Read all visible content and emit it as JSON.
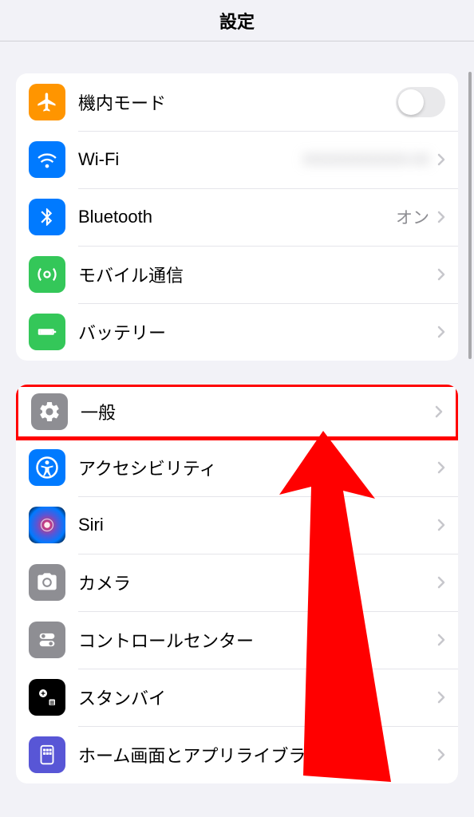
{
  "header": {
    "title": "設定"
  },
  "group1": {
    "airplane": {
      "label": "機内モード"
    },
    "wifi": {
      "label": "Wi-Fi",
      "detail": "XXXXXXXXXXXX-XX"
    },
    "bluetooth": {
      "label": "Bluetooth",
      "detail": "オン"
    },
    "cellular": {
      "label": "モバイル通信"
    },
    "battery": {
      "label": "バッテリー"
    }
  },
  "group2": {
    "general": {
      "label": "一般"
    },
    "accessibility": {
      "label": "アクセシビリティ"
    },
    "siri": {
      "label": "Siri"
    },
    "camera": {
      "label": "カメラ"
    },
    "control_center": {
      "label": "コントロールセンター"
    },
    "standby": {
      "label": "スタンバイ"
    },
    "home_screen": {
      "label": "ホーム画面とアプリライブラリ"
    }
  }
}
